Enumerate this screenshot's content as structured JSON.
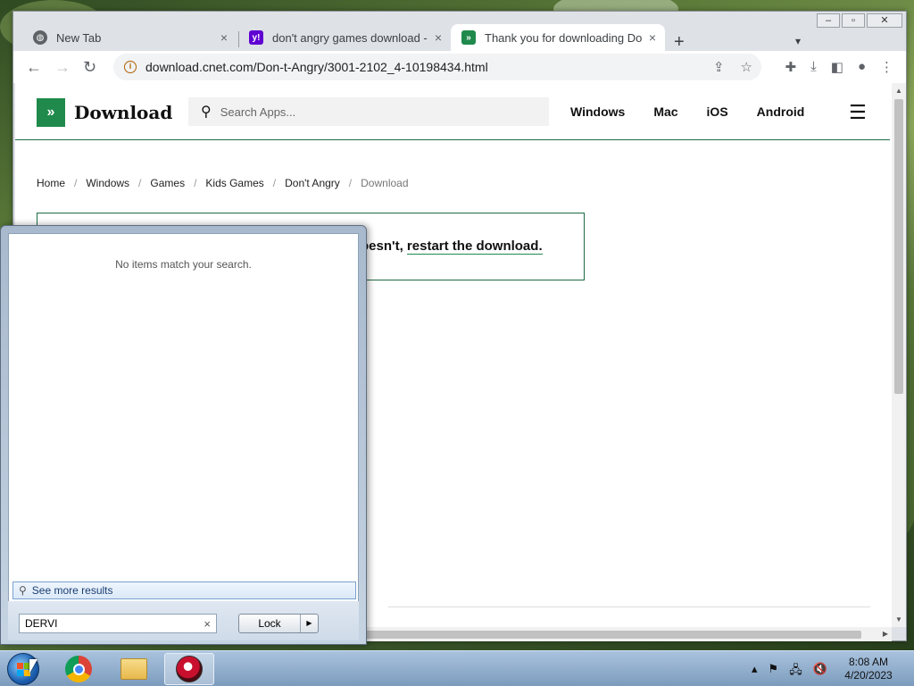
{
  "browser": {
    "tabs": [
      {
        "title": "New Tab",
        "close": "×"
      },
      {
        "title": "don't angry games download - C",
        "close": "×"
      },
      {
        "title": "Thank you for downloading Don",
        "close": "×"
      }
    ],
    "url": "download.cnet.com/Don-t-Angry/3001-2102_4-10198434.html"
  },
  "site": {
    "logo_text": "Download",
    "search_placeholder": "Search Apps...",
    "nav": [
      "Windows",
      "Mac",
      "iOS",
      "Android"
    ],
    "breadcrumb": [
      "Home",
      "Windows",
      "Games",
      "Kids Games",
      "Don't Angry"
    ],
    "breadcrumb_current": "Download",
    "notice_partial": "oesn't,",
    "notice_link": "restart the download."
  },
  "startmenu": {
    "empty_text": "No items match your search.",
    "see_more": "See more results",
    "search_value": "DERVI",
    "lock_label": "Lock"
  },
  "taskbar": {
    "time": "8:08 AM",
    "date": "4/20/2023"
  },
  "colors": {
    "brand_green": "#1f8a4c",
    "accent_border": "#1f6c45"
  }
}
